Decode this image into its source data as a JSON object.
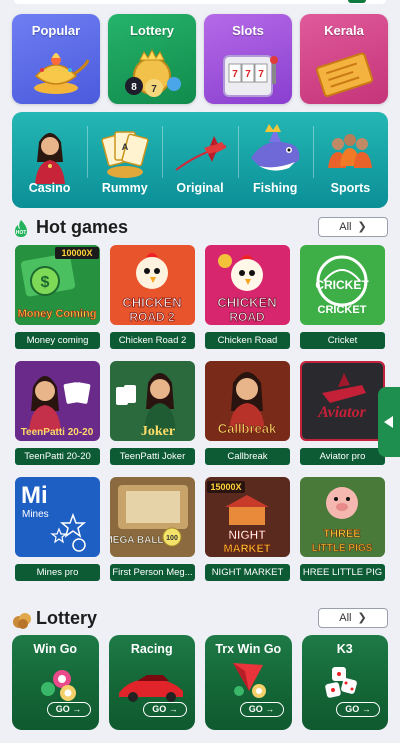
{
  "categories": [
    {
      "label": "Popular"
    },
    {
      "label": "Lottery"
    },
    {
      "label": "Slots"
    },
    {
      "label": "Kerala"
    }
  ],
  "game_types": [
    {
      "label": "Casino"
    },
    {
      "label": "Rummy"
    },
    {
      "label": "Original"
    },
    {
      "label": "Fishing"
    },
    {
      "label": "Sports"
    }
  ],
  "hot_games": {
    "title": "Hot games",
    "all_label": "All",
    "items": [
      {
        "name": "Money coming",
        "art_text": "Money Coming",
        "badge": "10000X"
      },
      {
        "name": "Chicken Road 2",
        "art_text": "CHICKEN ROAD 2"
      },
      {
        "name": "Chicken Road",
        "art_text": "CHICKEN ROAD"
      },
      {
        "name": "Cricket",
        "art_text": "CRICKET"
      },
      {
        "name": "TeenPatti 20-20",
        "art_text": "TeenPatti 20-20"
      },
      {
        "name": "TeenPatti Joker",
        "art_text": "Joker"
      },
      {
        "name": "Callbreak",
        "art_text": "Callbreak"
      },
      {
        "name": "Aviator pro",
        "art_text": "Aviator"
      },
      {
        "name": "Mines pro",
        "art_text": "Mi",
        "art_sub": "Mines"
      },
      {
        "name": "First Person Meg...",
        "art_text": "MEGA BALL"
      },
      {
        "name": "NIGHT MARKET",
        "art_text": "NIGHT MARKET",
        "badge": "15000X"
      },
      {
        "name": "HREE LITTLE PIG",
        "art_text": "THREE LITTLE PIGS"
      }
    ]
  },
  "lottery": {
    "title": "Lottery",
    "all_label": "All",
    "items": [
      {
        "title": "Win Go",
        "go": "GO"
      },
      {
        "title": "Racing",
        "go": "GO"
      },
      {
        "title": "Trx Win Go",
        "go": "GO"
      },
      {
        "title": "K3",
        "go": "GO"
      }
    ]
  },
  "icons": {
    "hot": "hot-flame-icon",
    "lottery": "lottery-coins-icon",
    "side_tab": "triangle-left-icon"
  },
  "colors": {
    "accent_green": "#0c5b35",
    "teal": "#0b8f97"
  }
}
